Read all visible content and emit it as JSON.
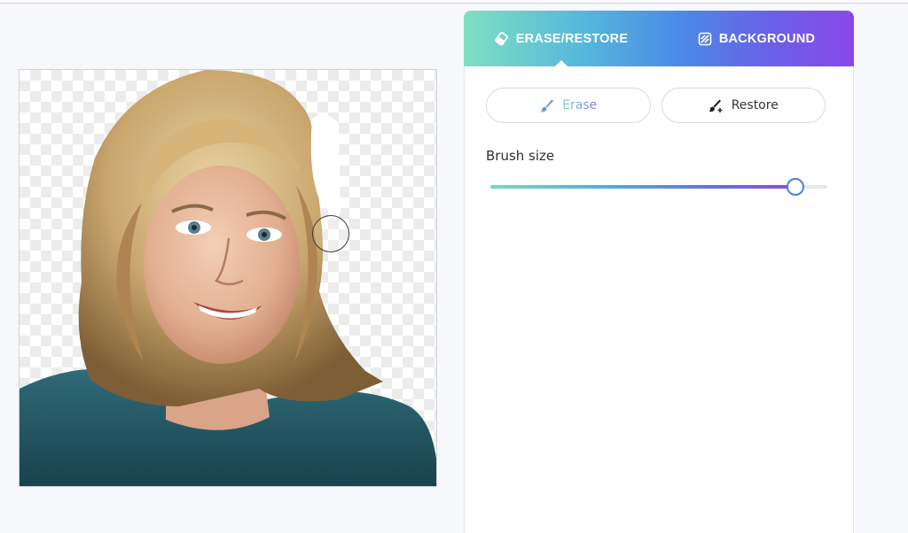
{
  "tabs": [
    {
      "label": "ERASE/RESTORE",
      "icon": "eraser-icon",
      "active": true
    },
    {
      "label": "BACKGROUND",
      "icon": "background-icon",
      "active": false
    }
  ],
  "modes": {
    "erase_label": "Erase",
    "restore_label": "Restore",
    "active": "erase"
  },
  "brush": {
    "label": "Brush size",
    "value_fraction": 0.905
  },
  "colors": {
    "tab_gradient_start": "#7fe0c1",
    "tab_gradient_end": "#8a48ea",
    "slider_thumb_border": "#4b7fe3"
  }
}
